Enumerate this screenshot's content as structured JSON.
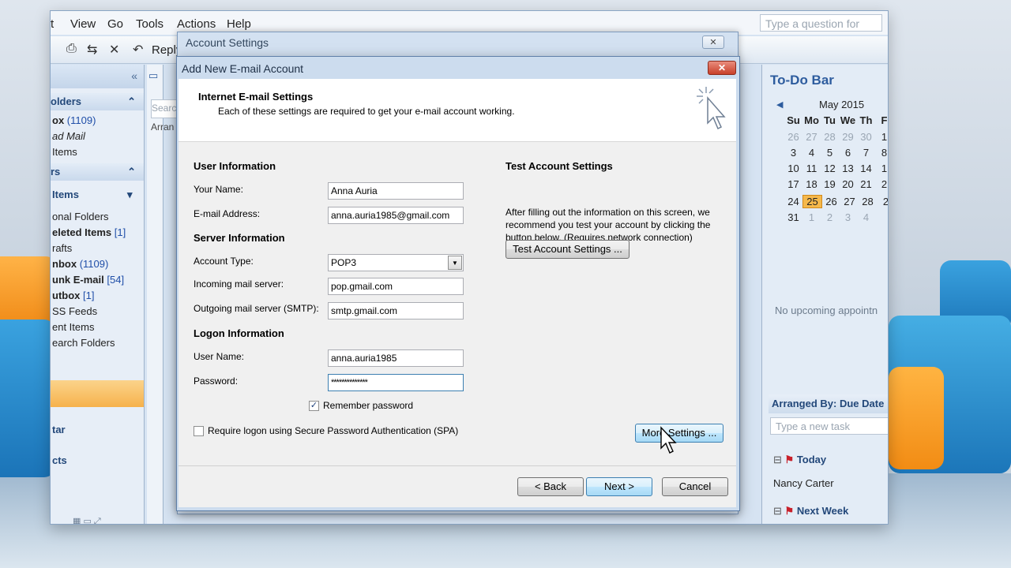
{
  "outlook": {
    "menu": [
      "t",
      "View",
      "Go",
      "Tools",
      "Actions",
      "Help"
    ],
    "question_placeholder": "Type a question for help",
    "reply_label": "Reply",
    "nav": {
      "section_folders": "olders",
      "items_top": [
        {
          "label": "ox",
          "count": "(1109)"
        },
        {
          "label": "ad Mail",
          "count": ""
        },
        {
          "label": "Items",
          "count": ""
        }
      ],
      "section_mail": "rs",
      "all_items": "Items",
      "folders": [
        {
          "label": "onal Folders",
          "count": ""
        },
        {
          "label": "eleted Items",
          "count": "[1]"
        },
        {
          "label": "rafts",
          "count": ""
        },
        {
          "label": "nbox",
          "count": "(1109)"
        },
        {
          "label": "unk E-mail",
          "count": "[54]"
        },
        {
          "label": "utbox",
          "count": "[1]"
        },
        {
          "label": "SS Feeds",
          "count": ""
        },
        {
          "label": "ent Items",
          "count": ""
        },
        {
          "label": "earch Folders",
          "count": ""
        }
      ],
      "bottom": [
        "tar",
        "cts"
      ]
    },
    "list": {
      "search": "Searc",
      "arrange": "Arran"
    },
    "todo": {
      "title": "To-Do Bar",
      "month": "May 2015",
      "weekdays": [
        "Su",
        "Mo",
        "Tu",
        "We",
        "Th",
        "F"
      ],
      "weeks": [
        [
          "26",
          "27",
          "28",
          "29",
          "30",
          "1"
        ],
        [
          "3",
          "4",
          "5",
          "6",
          "7",
          "8"
        ],
        [
          "10",
          "11",
          "12",
          "13",
          "14",
          "1"
        ],
        [
          "17",
          "18",
          "19",
          "20",
          "21",
          "2"
        ],
        [
          "24",
          "25",
          "26",
          "27",
          "28",
          "2"
        ],
        [
          "31",
          "1",
          "2",
          "3",
          "4",
          ""
        ]
      ],
      "today": "25",
      "no_appointments": "No upcoming appointn",
      "arranged_by": "Arranged By: Due Date",
      "new_task_placeholder": "Type a new task",
      "group_today": "Today",
      "task_item": "Nancy Carter",
      "group_next_week": "Next Week"
    }
  },
  "account_settings": {
    "title": "Account Settings",
    "close": "✕"
  },
  "dialog": {
    "title": "Add New E-mail Account",
    "close": "✕",
    "header_title": "Internet E-mail Settings",
    "header_subtitle": "Each of these settings are required to get your e-mail account working.",
    "user_info": {
      "heading": "User Information",
      "your_name_label": "Your Name:",
      "your_name_value": "Anna Auria",
      "email_label": "E-mail Address:",
      "email_value": "anna.auria1985@gmail.com"
    },
    "server_info": {
      "heading": "Server Information",
      "account_type_label": "Account Type:",
      "account_type_value": "POP3",
      "incoming_label": "Incoming mail server:",
      "incoming_value": "pop.gmail.com",
      "outgoing_label": "Outgoing mail server (SMTP):",
      "outgoing_value": "smtp.gmail.com"
    },
    "logon_info": {
      "heading": "Logon Information",
      "user_name_label": "User Name:",
      "user_name_value": "anna.auria1985",
      "password_label": "Password:",
      "password_value": "**************",
      "remember_label": "Remember password",
      "remember_checked": true,
      "spa_label": "Require logon using Secure Password Authentication (SPA)",
      "spa_checked": false
    },
    "test": {
      "heading": "Test Account Settings",
      "text": "After filling out the information on this screen, we recommend you test your account by clicking the button below. (Requires network connection)",
      "button": "Test Account Settings ..."
    },
    "more_settings": "More Settings ...",
    "back": "< Back",
    "next": "Next >",
    "cancel": "Cancel"
  },
  "colors": {
    "accent": "#3c7fb1",
    "title_blue": "#2d5c9e",
    "close_red": "#c8402a",
    "today_highlight": "#f5b84b"
  }
}
